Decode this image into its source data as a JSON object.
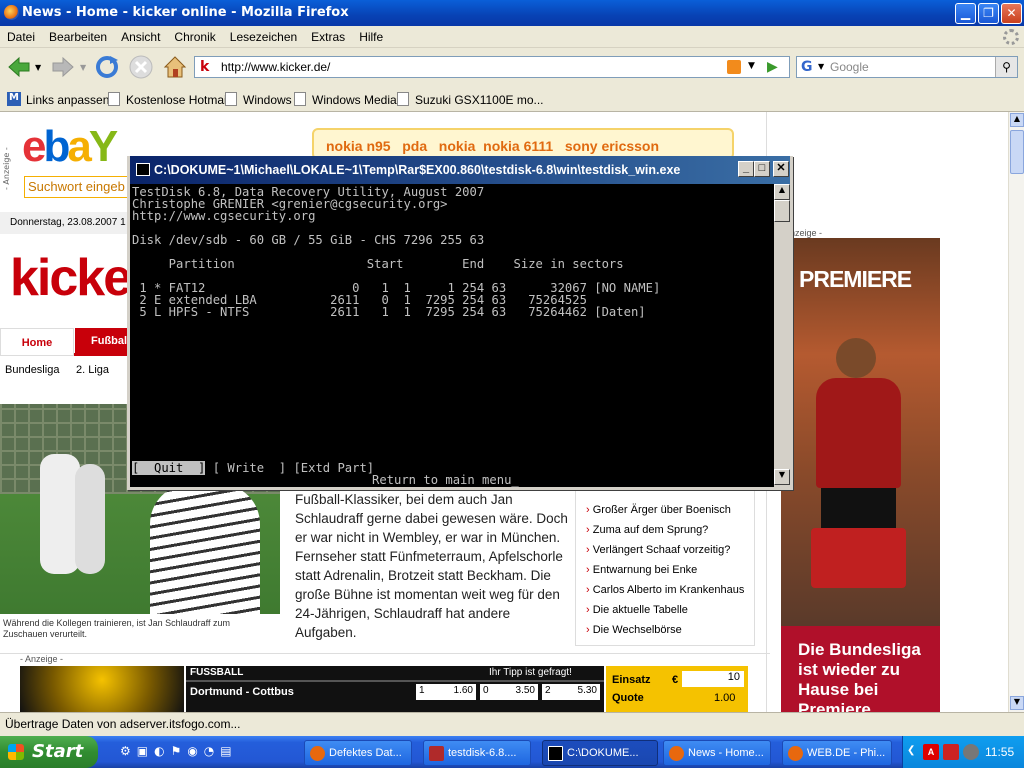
{
  "browser": {
    "title": "News - Home - kicker online - Mozilla Firefox",
    "menu": [
      "Datei",
      "Bearbeiten",
      "Ansicht",
      "Chronik",
      "Lesezeichen",
      "Extras",
      "Hilfe"
    ],
    "url": "http://www.kicker.de/",
    "search_placeholder": "Google",
    "bookmarks": [
      "Links anpassen",
      "Kostenlose Hotmail",
      "Windows",
      "Windows Media",
      "Suzuki GSX1100E mo..."
    ],
    "status": "Übertrage Daten von adserver.itsfogo.com..."
  },
  "page": {
    "ad_label": "- Anzeige -",
    "ebay_search": "Suchwort eingeb",
    "nokia_ad": "nokia n95   pda   nokia  nokia 6111   sony ericsson",
    "date": "Donnerstag, 23.08.2007 1",
    "logo": "kicke",
    "nav_home": "Home",
    "nav_fussball": "Fußbal",
    "subnav": [
      "Bundesliga",
      "2. Liga"
    ],
    "ad_label_right": "nzeige -",
    "premiere_logo": "PREMIERE",
    "article_lines": [
      "Fußball-Klassiker, bei dem auch Jan",
      "Schlaudraff gerne dabei gewesen wäre. Doch",
      "er war nicht in Wembley, er war in München.",
      "Fernseher statt Fünfmeterraum, Apfelschorle",
      "statt Adrenalin, Brotzeit statt Beckham. Die",
      "große Bühne ist momentan weit weg für den",
      "24-Jährigen, Schlaudraff hat andere Aufgaben."
    ],
    "photo_caption": "Während die Kollegen trainieren, ist Jan Schlaudraff zum Zuschauen verurteilt.",
    "news_links": [
      "Großer Ärger über Boenisch",
      "Zuma auf dem Sprung?",
      "Verlängert Schaaf vorzeitig?",
      "Entwarnung bei Enke",
      "Carlos Alberto im Krankenhaus",
      "Die aktuelle Tabelle",
      "Die Wechselbörse"
    ],
    "promo_lines": [
      "Die Bundesliga",
      "ist wieder zu",
      "Hause bei",
      "Premiere"
    ],
    "bet": {
      "header_left": "FUSSBALL",
      "header_right": "Ihr Tipp ist gefragt!",
      "match": "Dortmund - Cottbus",
      "odds": [
        {
          "k": "1",
          "v": "1.60"
        },
        {
          "k": "0",
          "v": "3.50"
        },
        {
          "k": "2",
          "v": "5.30"
        }
      ],
      "einsatz_label": "Einsatz",
      "currency": "€",
      "einsatz_value": "10",
      "quote_label": "Quote",
      "quote_value": "1.00"
    },
    "bottom_ad_label": "- Anzeige -"
  },
  "console": {
    "title": "C:\\DOKUME~1\\Michael\\LOKALE~1\\Temp\\Rar$EX00.860\\testdisk-6.8\\win\\testdisk_win.exe",
    "lines": [
      "TestDisk 6.8, Data Recovery Utility, August 2007",
      "Christophe GRENIER <grenier@cgsecurity.org>",
      "http://www.cgsecurity.org",
      "",
      "Disk /dev/sdb - 60 GB / 55 GiB - CHS 7296 255 63",
      "",
      "     Partition                  Start        End    Size in sectors",
      "",
      " 1 * FAT12                    0   1  1     1 254 63      32067 [NO NAME]",
      " 2 E extended LBA          2611   0  1  7295 254 63   75264525",
      " 5 L HPFS - NTFS           2611   1  1  7295 254 63   75264462 [Daten]"
    ],
    "menu_quit": "[  Quit  ]",
    "menu_write": "[ Write  ]",
    "menu_extd": "[Extd Part]",
    "hint": "Return to main menu"
  },
  "taskbar": {
    "start": "Start",
    "tasks": [
      "Defektes Dat...",
      "testdisk-6.8....",
      "C:\\DOKUME...",
      "News - Home...",
      "WEB.DE - Phi..."
    ],
    "clock": "11:55"
  },
  "colors": {
    "kicker_red": "#c8000a",
    "xp_blue": "#245edb",
    "console_bg": "#000000"
  }
}
